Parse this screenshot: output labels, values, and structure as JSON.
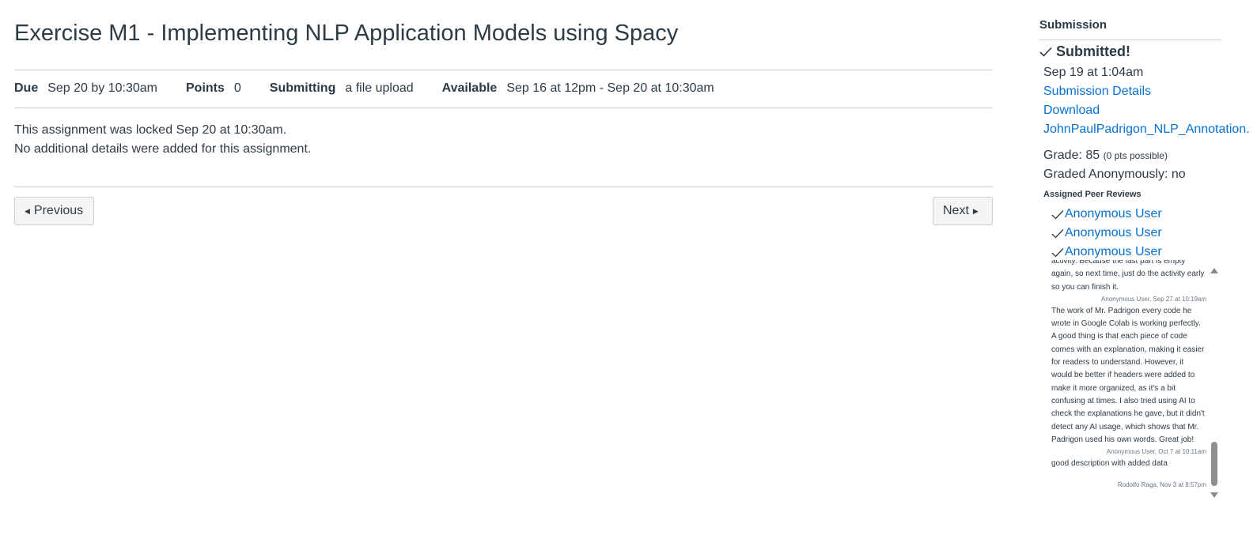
{
  "assignment": {
    "title": "Exercise M1 - Implementing NLP Application Models using Spacy",
    "details": [
      {
        "label": "Due",
        "value": "Sep 20 by 10:30am"
      },
      {
        "label": "Points",
        "value": "0"
      },
      {
        "label": "Submitting",
        "value": "a file upload"
      },
      {
        "label": "Available",
        "value": "Sep 16 at 12pm - Sep 20 at 10:30am"
      }
    ],
    "locked_message": "This assignment was locked Sep 20 at 10:30am.",
    "no_details_message": "No additional details were added for this assignment."
  },
  "nav": {
    "previous_label": "Previous",
    "next_label": "Next"
  },
  "submission": {
    "heading": "Submission",
    "status": "Submitted!",
    "submitted_at": "Sep 19 at 1:04am",
    "details_link": "Submission Details",
    "download_link": "Download",
    "file_name": "JohnPaulPadrigon_NLP_Annotation.",
    "grade_label": "Grade: 85",
    "grade_possible": "(0 pts possible)",
    "graded_anonymously": "Graded Anonymously: no",
    "peer_reviews_heading": "Assigned Peer Reviews",
    "peer_reviews": [
      "Anonymous User",
      "Anonymous User",
      "Anonymous User"
    ]
  },
  "comments": [
    {
      "text": "activity. Because the last part is empty again, so next time, just do the activity early so you can finish it.",
      "meta": "Anonymous User, Sep 27 at 10:19am"
    },
    {
      "text": "The work of Mr. Padrigon every code he wrote in Google Colab is working perfectly. A good thing is that each piece of code comes with an explanation, making it easier for readers to understand. However, it would be better if headers were added to make it more organized, as it's a bit confusing at times. I also tried using AI to check the explanations he gave, but it didn't detect any AI usage, which shows that Mr. Padrigon used his own words. Great job!",
      "meta": "Anonymous User, Oct 7 at 10:11am"
    },
    {
      "text": "good description with added data",
      "meta": "Rodolfo Raga, Nov 3 at 8:57pm"
    }
  ],
  "icons": {
    "check": "check-icon",
    "caret_left": "caret-left-icon",
    "caret_right": "caret-right-icon"
  },
  "colors": {
    "text": "#2d3b45",
    "link": "#0770d0",
    "border": "#c7cdd1",
    "button_bg": "#f5f5f5"
  }
}
